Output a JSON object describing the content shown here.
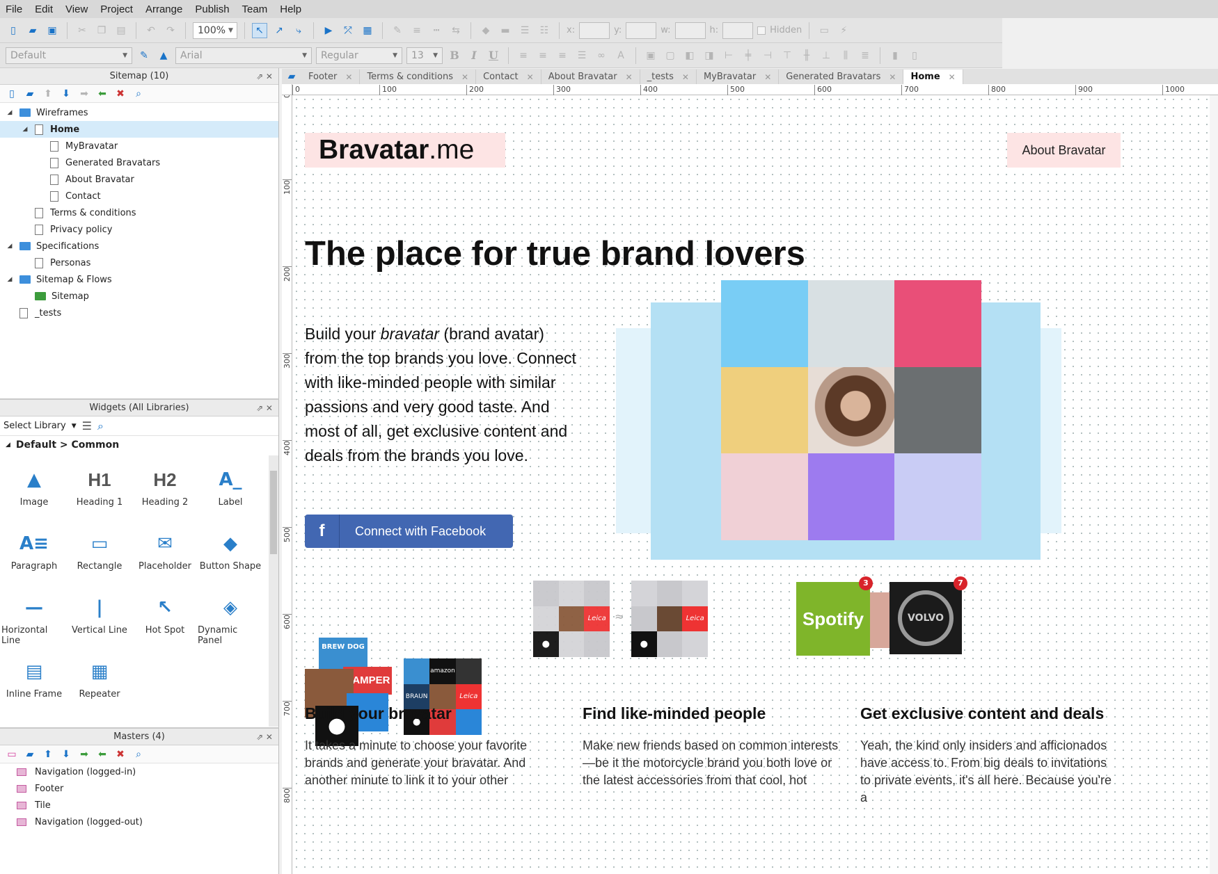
{
  "menu": [
    "File",
    "Edit",
    "View",
    "Project",
    "Arrange",
    "Publish",
    "Team",
    "Help"
  ],
  "toolbar": {
    "zoom": "100%",
    "style": "Default",
    "font": "Arial",
    "weight": "Regular",
    "size": "13",
    "x_label": "x:",
    "y_label": "y:",
    "w_label": "w:",
    "h_label": "h:",
    "hidden_label": "Hidden"
  },
  "sitemap": {
    "title": "Sitemap (10)",
    "items": [
      {
        "label": "Wireframes",
        "type": "folder",
        "level": 0,
        "twisty": "◢"
      },
      {
        "label": "Home",
        "type": "page",
        "level": 1,
        "twisty": "◢",
        "selected": true
      },
      {
        "label": "MyBravatar",
        "type": "page",
        "level": 2
      },
      {
        "label": "Generated Bravatars",
        "type": "page",
        "level": 2
      },
      {
        "label": "About Bravatar",
        "type": "page",
        "level": 2
      },
      {
        "label": "Contact",
        "type": "page",
        "level": 2
      },
      {
        "label": "Terms & conditions",
        "type": "page",
        "level": 1
      },
      {
        "label": "Privacy policy",
        "type": "page",
        "level": 1
      },
      {
        "label": "Specifications",
        "type": "folder",
        "level": 0,
        "twisty": "◢"
      },
      {
        "label": "Personas",
        "type": "page",
        "level": 1
      },
      {
        "label": "Sitemap & Flows",
        "type": "folder",
        "level": 0,
        "twisty": "◢"
      },
      {
        "label": "Sitemap",
        "type": "flow",
        "level": 1
      },
      {
        "label": "_tests",
        "type": "page",
        "level": 0
      }
    ]
  },
  "widgets": {
    "title": "Widgets (All Libraries)",
    "select_library": "Select Library",
    "group": "Default > Common",
    "items": [
      {
        "label": "Image",
        "glyph": "▲"
      },
      {
        "label": "Heading 1",
        "glyph": "H1"
      },
      {
        "label": "Heading 2",
        "glyph": "H2"
      },
      {
        "label": "Label",
        "glyph": "A_"
      },
      {
        "label": "Paragraph",
        "glyph": "A≡"
      },
      {
        "label": "Rectangle",
        "glyph": "▭"
      },
      {
        "label": "Placeholder",
        "glyph": "✉"
      },
      {
        "label": "Button Shape",
        "glyph": "◆"
      },
      {
        "label": "Horizontal Line",
        "glyph": "—"
      },
      {
        "label": "Vertical Line",
        "glyph": "|"
      },
      {
        "label": "Hot Spot",
        "glyph": "↖"
      },
      {
        "label": "Dynamic Panel",
        "glyph": "◈"
      },
      {
        "label": "Inline Frame",
        "glyph": "▤"
      },
      {
        "label": "Repeater",
        "glyph": "▦"
      }
    ]
  },
  "masters": {
    "title": "Masters (4)",
    "items": [
      "Navigation (logged-in)",
      "Footer",
      "Tile",
      "Navigation (logged-out)"
    ]
  },
  "tabs": [
    {
      "label": "Footer"
    },
    {
      "label": "Terms & conditions"
    },
    {
      "label": "Contact"
    },
    {
      "label": "About Bravatar"
    },
    {
      "label": "_tests"
    },
    {
      "label": "MyBravatar"
    },
    {
      "label": "Generated Bravatars"
    },
    {
      "label": "Home",
      "active": true
    }
  ],
  "ruler": {
    "h": [
      "0",
      "100",
      "200",
      "300",
      "400",
      "500",
      "600",
      "700",
      "800",
      "900",
      "1000"
    ],
    "v": [
      "0",
      "100",
      "200",
      "300",
      "400",
      "500",
      "600",
      "700",
      "800"
    ]
  },
  "page": {
    "logo_bold": "Bravatar",
    "logo_light": ".me",
    "about_button": "About Bravatar",
    "hero": "The place for true brand lovers",
    "intro_1": "Build your ",
    "intro_em": "bravatar",
    "intro_2": " (brand avatar) from the top brands you love. Connect with like-minded people with similar passions and very good taste. And most of all, get exclusive content and deals from the brands you love.",
    "fb_button": "Connect with Facebook",
    "grid_colors": [
      "#79cdf5",
      "#d8e0e3",
      "#e94f78",
      "#efcf7d",
      "#photo",
      "#6b6f71",
      "#f0d0d6",
      "#9d7bef",
      "#c9ccf5"
    ],
    "features": [
      {
        "title": "Build your bravatar",
        "text": "It takes a minute to choose your favorite brands and generate your bravatar. And another minute to link it to your other"
      },
      {
        "title": "Find like-minded people",
        "text": "Make new friends based on common interests —be it the motorcycle brand you both love or the latest accessories from that cool, hot"
      },
      {
        "title": "Get exclusive content and deals",
        "text": "Yeah, the kind only insiders and afficionados have access to. From big deals to invitations to private events, it's all here. Because you're a"
      }
    ],
    "brands": {
      "camper": "CAMPER",
      "amazon": "amazon",
      "braun": "BRAUN",
      "leica": "Leica",
      "spotify": "Spotify",
      "volvo": "VOLVO",
      "brewdog": "BREW DOG",
      "badge_1": "3",
      "badge_2": "7"
    }
  }
}
